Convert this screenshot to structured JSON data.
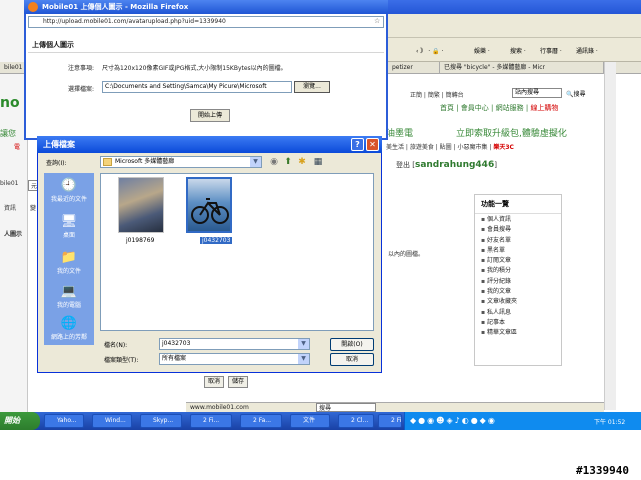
{
  "popup": {
    "title": "Mobile01 上傳個人圖示 - Mozilla Firefox",
    "url": "http://upload.mobile01.com/avatarupload.php?uid=1339940",
    "heading": "上傳個人圖示",
    "note_label": "注意事項:",
    "note_text": "尺寸為120x120像素GIF或JPG格式,大小限制15KBytes以內的圖檔。",
    "file_label": "選擇檔案:",
    "file_value": "C:\\Documents and Setting\\Samca\\My Picure\\Microsoft",
    "browse_label": "瀏覽...",
    "upload_label": "開始上傳"
  },
  "dialog": {
    "title": "上傳檔案",
    "lookin_label": "查詢(I):",
    "lookin_value": "Microsoft 多媒體藝廊",
    "places": [
      {
        "label": "我最近的文件",
        "icon": "recent-docs-icon",
        "glyph": "🕘"
      },
      {
        "label": "桌面",
        "icon": "desktop-icon",
        "glyph": "🖥"
      },
      {
        "label": "我的文件",
        "icon": "my-documents-icon",
        "glyph": "📁"
      },
      {
        "label": "我的電腦",
        "icon": "my-computer-icon",
        "glyph": "💻"
      },
      {
        "label": "網路上的芳鄰",
        "icon": "network-places-icon",
        "glyph": "🌐"
      }
    ],
    "files": [
      {
        "name": "j0198769",
        "selected": false
      },
      {
        "name": "j0432703",
        "selected": true
      }
    ],
    "filename_label": "檔名(N):",
    "filename_value": "j0432703",
    "filetype_label": "檔案類型(T):",
    "filetype_value": "所有檔案",
    "open_label": "開啟(O)",
    "cancel_label": "取消",
    "help_glyph": "?",
    "close_glyph": "✕"
  },
  "background": {
    "toolbar_items": [
      "‹ 》 · 🔒 ·",
      "娛樂 ·",
      "搜索 ·",
      "行事曆 ·",
      "通訊錄 ·"
    ],
    "tab_left": "bile01",
    "tab_mid": "petizer",
    "tab_right": "已搜尋 \"bicycle\" - 多媒體藝廊 - Micr",
    "site_links": "正簡 | 簡繁 | 簡轉台",
    "search_value": "站內搜尋",
    "search_btn": "搜尋",
    "nav_links": "首頁 | 會員中心 | 網站服務 |",
    "nav_red": "線上購物",
    "promo_left": "油墨電",
    "promo_right": "立即索取升級包,體驗虛擬化",
    "edge_promo": "讓您",
    "edge_red": "電",
    "cat_links": "美生活 | 旅遊美食 | 貼圖 | 小惡魔市集 |",
    "cat_red": "樂天3C",
    "login_prefix": "登出 [",
    "login_name": "sandrahung446",
    "login_suffix": "]",
    "edge_member": "bile01",
    "edge_box": "元",
    "edge_info": "資訊",
    "edge_info2": "變",
    "edge_avatar": "人圖示",
    "side_note": "以內的圖檔。",
    "menu_title": "功能一覽",
    "menu_items": [
      "個人資訊",
      "會員搜尋",
      "好友名單",
      "黑名單",
      "訂閱文章",
      "我的積分",
      "評分紀錄",
      "我的文章",
      "文章收藏夾",
      "私人訊息",
      "記事本",
      "精華文章區"
    ],
    "cancel_btn": "取消",
    "save_btn": "儲存",
    "status": "www.mobile01.com",
    "status_search": "搜尋"
  },
  "taskbar": {
    "start": "開始",
    "tasks": [
      "Yaho...",
      "Wind...",
      "Skyp...",
      "2 Fi...",
      "2 Fa...",
      "文件",
      "2 Cl...",
      "2 Fi..."
    ],
    "clock": "下午 01:52"
  },
  "watermark": "#1339940"
}
